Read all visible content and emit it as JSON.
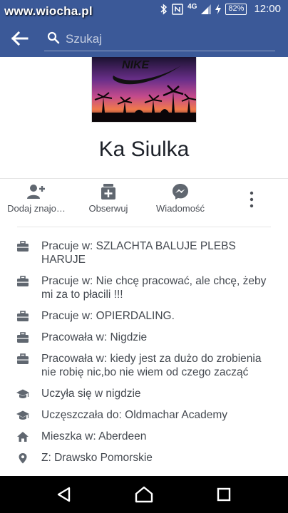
{
  "status_bar": {
    "watermark": "www.wiocha.pl",
    "network": "4G",
    "battery": "82%",
    "time": "12:00"
  },
  "search": {
    "placeholder": "Szukaj"
  },
  "profile": {
    "name": "Ka Siulka"
  },
  "actions": {
    "add_friend": "Dodaj znajo…",
    "follow": "Obserwuj",
    "message": "Wiadomość"
  },
  "about": [
    {
      "icon": "briefcase-icon",
      "text": "Pracuje w: SZLACHTA BALUJE PLEBS HARUJE"
    },
    {
      "icon": "briefcase-icon",
      "text": "Pracuje w: Nie chcę pracować, ale chcę, żeby mi za to płacili !!!"
    },
    {
      "icon": "briefcase-icon",
      "text": "Pracuje w: OPIERDALING."
    },
    {
      "icon": "briefcase-icon",
      "text": "Pracowała w: Nigdzie"
    },
    {
      "icon": "briefcase-icon",
      "text": "Pracowała w: kiedy jest za dużo do zrobienia nie robię nic,bo nie wiem od czego zacząć"
    },
    {
      "icon": "graduation-cap-icon",
      "text": "Uczyła się w nigdzie"
    },
    {
      "icon": "graduation-cap-icon",
      "text": "Uczęszczała do: Oldmachar Academy"
    },
    {
      "icon": "home-icon",
      "text": "Mieszka w: Aberdeen"
    },
    {
      "icon": "location-pin-icon",
      "text": "Z: Drawsko Pomorskie"
    }
  ],
  "colors": {
    "header": "#3b5998",
    "icon_gray": "#606770",
    "nav_bar": "#000000"
  }
}
